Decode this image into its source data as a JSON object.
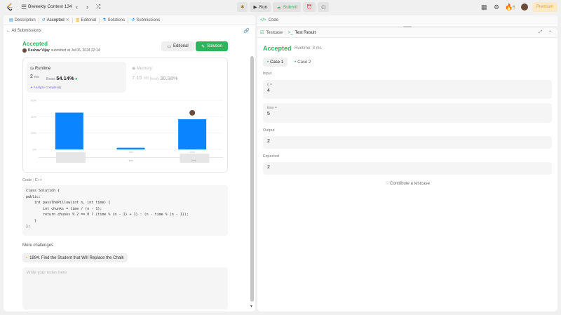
{
  "topbar": {
    "contest_name": "Biweekly Contest 134",
    "run_label": "Run",
    "submit_label": "Submit",
    "streak_count": "6",
    "premium_label": "Premium"
  },
  "left": {
    "tabs": [
      "Description",
      "Accepted",
      "Editorial",
      "Solutions",
      "Submissions"
    ],
    "back_label": "All Submissions",
    "status": "Accepted",
    "author_name": "Keshav Vijay",
    "submitted_text": "submitted at Jul 06, 2024 22:14",
    "editorial_btn": "Editorial",
    "solution_btn": "Solution",
    "runtime": {
      "label": "Runtime",
      "value": "2",
      "unit": "ms",
      "beats_label": "Beats",
      "beats_value": "54.14%",
      "analyze_label": "Analyze Complexity"
    },
    "memory": {
      "label": "Memory",
      "value": "7.15",
      "unit": "MB",
      "beats_label": "Beats",
      "beats_value": "30.58%"
    },
    "code_label": "Code",
    "language": "C++",
    "code_lines": [
      "class Solution {",
      "public:",
      "    int passThePillow(int n, int time) {",
      "        int chunks = time / (n - 1);",
      "        return chunks % 2 == 0 ? (time % (n - 1) + 1) : (n - time % (n - 1));",
      "    }",
      "};"
    ],
    "more_label": "More challenges",
    "challenge_item": "1894. Find the Student that Will Replace the Chalk",
    "notes_placeholder": "Write your notes here"
  },
  "chart_data": {
    "type": "bar",
    "yticks": [
      "60%",
      "40%",
      "20%",
      "0%"
    ],
    "ylim": [
      0,
      60
    ],
    "values": [
      45,
      2,
      37
    ],
    "xticks": [
      "",
      "1ms",
      "2ms"
    ],
    "highlight_index": 2,
    "nav_labels": [
      "1ms",
      "2ms"
    ],
    "colors": {
      "bar": "#0a84ff",
      "grid": "#ececec"
    }
  },
  "right": {
    "top_tab": "Code",
    "tabs": [
      "Testcase",
      "Test Result"
    ],
    "result": "Accepted",
    "runtime_text": "Runtime: 3 ms",
    "cases": [
      "Case 1",
      "Case 2"
    ],
    "input_label": "Input",
    "inputs": [
      {
        "name": "n =",
        "value": "4"
      },
      {
        "name": "time =",
        "value": "5"
      }
    ],
    "output_label": "Output",
    "output_value": "2",
    "expected_label": "Expected",
    "expected_value": "2",
    "contribute_label": "Contribute a testcase"
  },
  "colors": {
    "accent": "#2db55d",
    "premium": "#e0a33b",
    "bar": "#0a84ff"
  }
}
